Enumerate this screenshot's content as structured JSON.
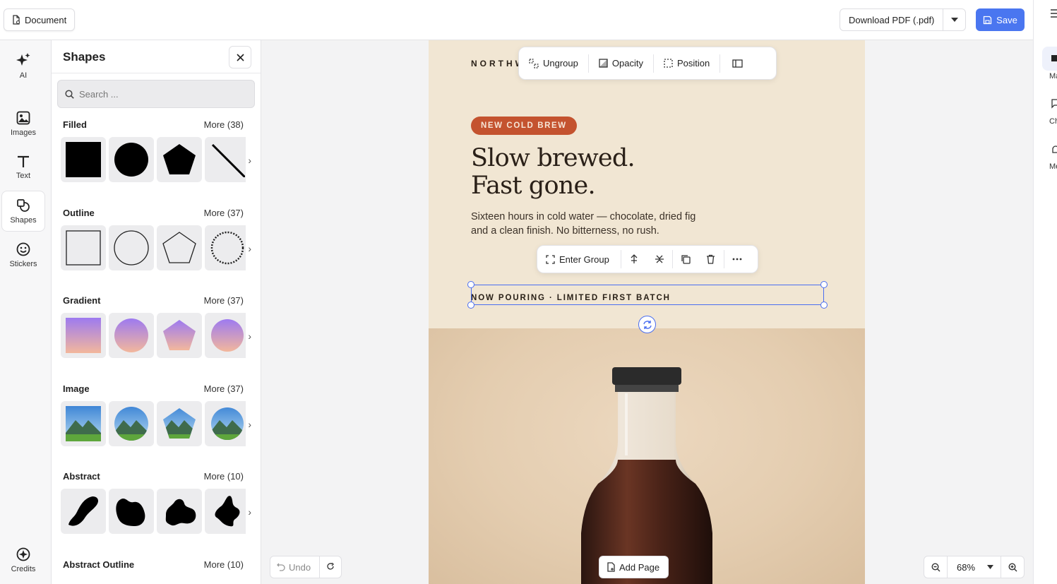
{
  "topbar": {
    "document_label": "Document",
    "download_label": "Download PDF (.pdf)",
    "save_label": "Save"
  },
  "right_strip": {
    "items": [
      "Ma",
      "Ch",
      "Me"
    ]
  },
  "rail": {
    "items": [
      {
        "label": "AI",
        "icon": "sparkle-icon"
      },
      {
        "label": "Images",
        "icon": "image-icon"
      },
      {
        "label": "Text",
        "icon": "text-icon"
      },
      {
        "label": "Shapes",
        "icon": "shapes-icon",
        "active": true
      },
      {
        "label": "Stickers",
        "icon": "sticker-icon"
      }
    ],
    "credits_label": "Credits"
  },
  "panel": {
    "title": "Shapes",
    "search_placeholder": "Search ...",
    "sections": [
      {
        "title": "Filled",
        "more": "More (38)"
      },
      {
        "title": "Outline",
        "more": "More (37)"
      },
      {
        "title": "Gradient",
        "more": "More (37)"
      },
      {
        "title": "Image",
        "more": "More (37)"
      },
      {
        "title": "Abstract",
        "more": "More (10)"
      },
      {
        "title": "Abstract Outline",
        "more": "More (10)"
      }
    ]
  },
  "group_toolbar": {
    "ungroup": "Ungroup",
    "opacity": "Opacity",
    "position": "Position"
  },
  "element_toolbar": {
    "enter_group": "Enter Group"
  },
  "page": {
    "brand": "NORTHW",
    "tag": "NEW COLD BREW",
    "headline_1": "Slow brewed.",
    "headline_2": "Fast gone.",
    "body": "Sixteen hours in cold water — chocolate, dried fig and a clean finish. No bitterness, no rush.",
    "pour_line": "NOW POURING · LIMITED FIRST BATCH"
  },
  "bottom": {
    "undo": "Undo",
    "add_page": "Add Page",
    "zoom": "68%"
  },
  "colors": {
    "accent": "#4a76f0",
    "page_bg": "#f1e6d3",
    "tag_bg": "#c4532f"
  }
}
